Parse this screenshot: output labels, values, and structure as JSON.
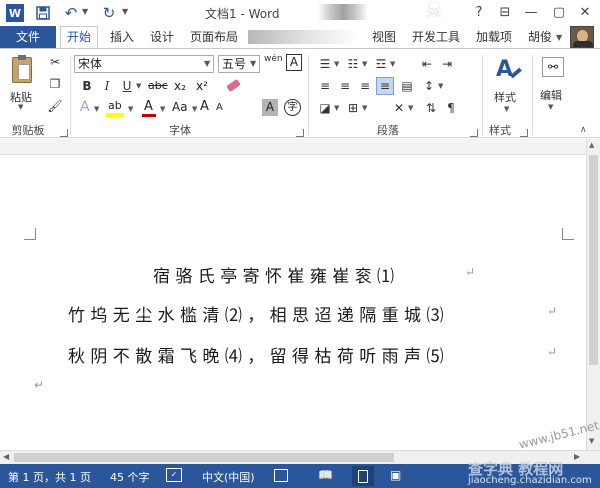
{
  "window": {
    "title": "文档1 - Word",
    "help": "?",
    "minimize": "—",
    "restore": "▢",
    "close": "✕",
    "ribbon_toggle": "⊟"
  },
  "tabs": {
    "file": "文件",
    "home": "开始",
    "insert": "插入",
    "design": "设计",
    "layout": "页面布局",
    "view": "视图",
    "developer": "开发工具",
    "addins": "加载项",
    "user": "胡俊"
  },
  "ribbon": {
    "clipboard": {
      "paste": "粘贴",
      "label": "剪贴板"
    },
    "font": {
      "family": "宋体",
      "size": "五号",
      "label": "字体",
      "bold": "B",
      "italic": "I",
      "underline": "U",
      "strike": "abc",
      "subscript": "x₂",
      "superscript": "x²",
      "grow": "A",
      "shrink": "A",
      "case": "Aa",
      "highlight": "ab",
      "color": "A",
      "wen": "wén",
      "boxA": "A",
      "charshade": "A",
      "encircle": "字"
    },
    "paragraph": {
      "label": "段落"
    },
    "styles": {
      "button": "样式",
      "label": "样式"
    },
    "editing": {
      "button": "编辑"
    }
  },
  "document": {
    "lines": [
      "宿 骆 氏 亭 寄 怀 崔 雍 崔 衮 ⑴",
      "竹 坞 无 尘 水 槛 清 ⑵ ， 相 思 迢 递 隔 重 城 ⑶",
      "秋 阴 不 散 霜 飞 晚 ⑷ ， 留 得 枯 荷 听 雨 声 ⑸"
    ],
    "para_mark": "↵"
  },
  "statusbar": {
    "page": "第 1 页，共 1 页",
    "words": "45 个字",
    "language": "中文(中国)"
  },
  "watermark": {
    "site": "www.jb51.net",
    "brand": "查字典 教程网",
    "url": "jiaocheng.chazidian.com"
  },
  "colors": {
    "accent": "#2b579a"
  }
}
